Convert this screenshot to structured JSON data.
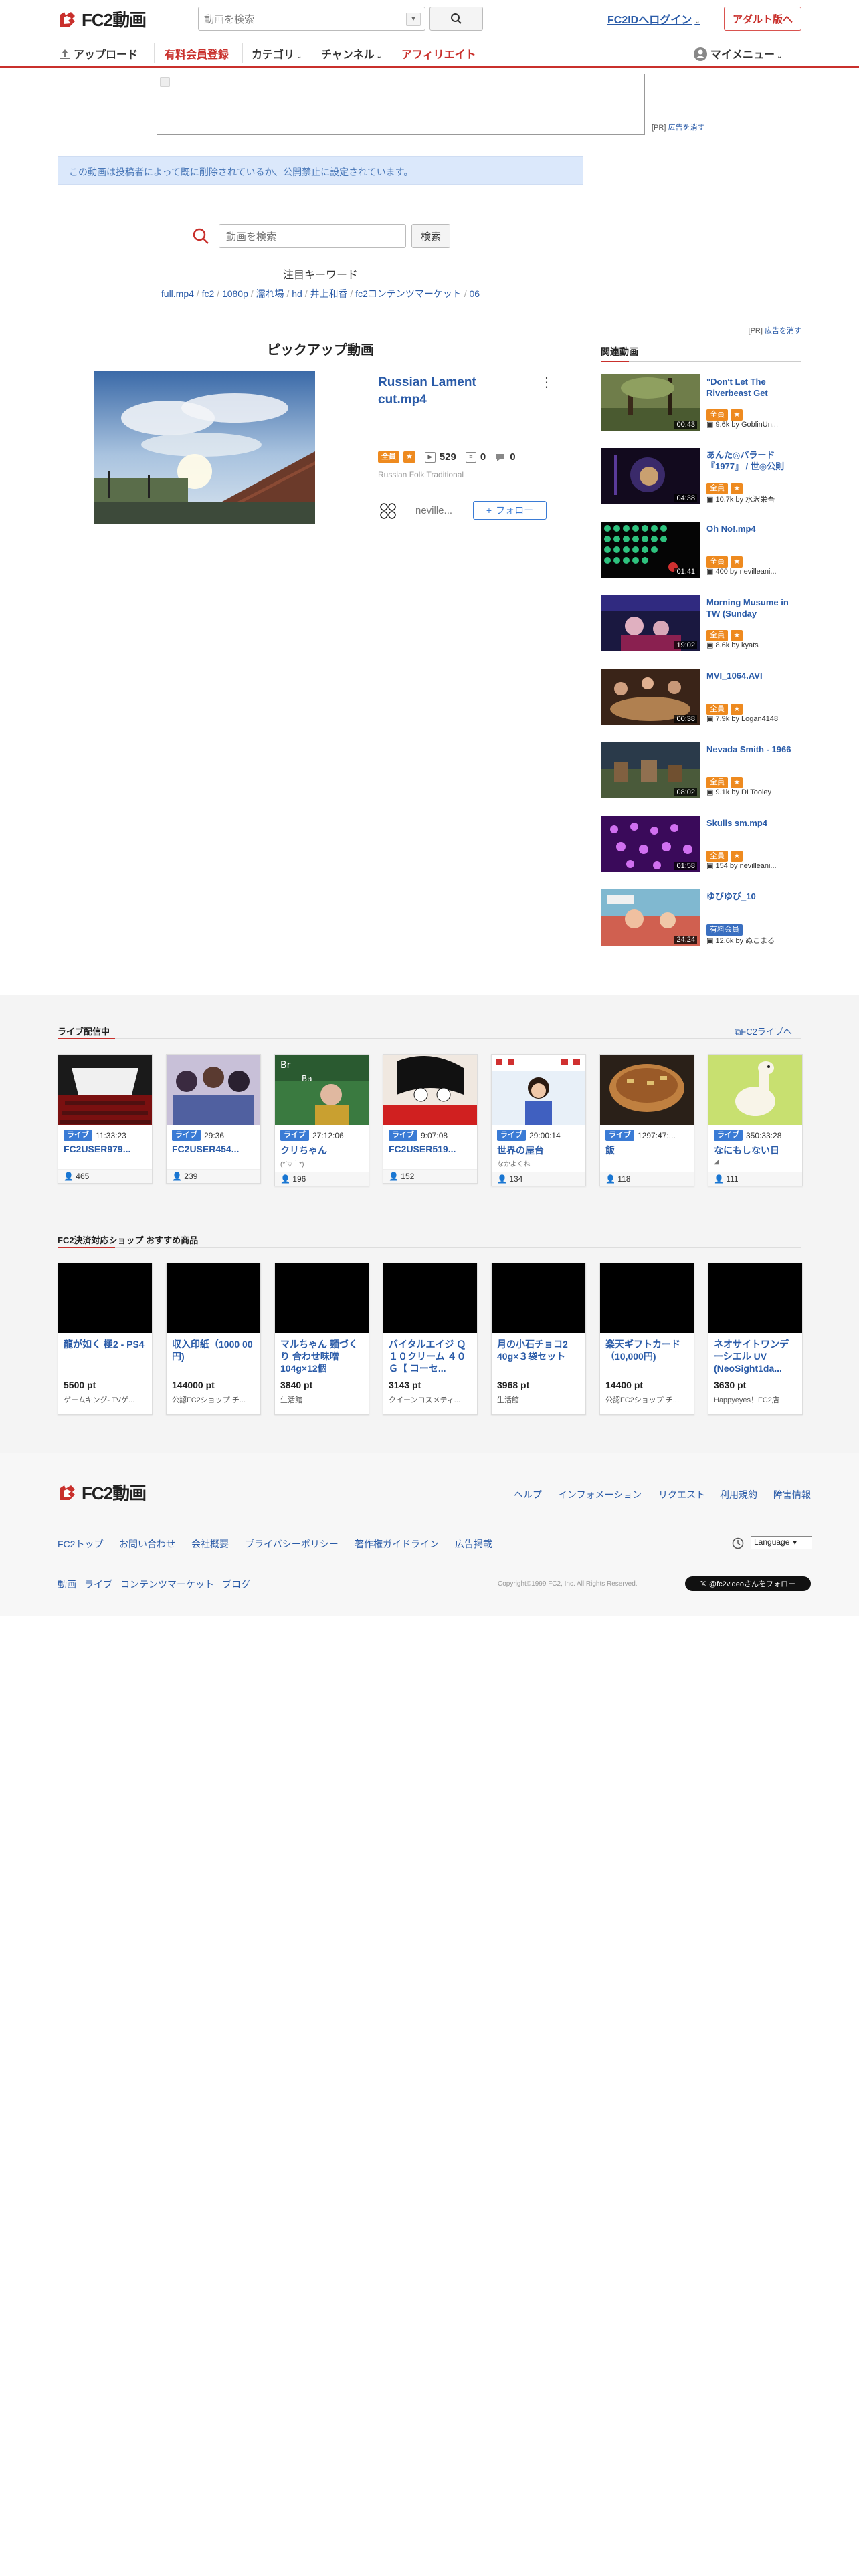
{
  "header": {
    "logo": "FC2動画",
    "search_placeholder": "動画を検索",
    "login": "FC2IDへログイン",
    "adult": "アダルト版へ"
  },
  "nav": {
    "upload": "アップロード",
    "premium": "有料会員登録",
    "category": "カテゴリ",
    "channel": "チャンネル",
    "affiliate": "アフィリエイト",
    "mymenu": "マイメニュー"
  },
  "ad": {
    "pr": "[PR]",
    "hide": "広告を消す"
  },
  "notice": "この動画は投稿者によって既に削除されているか、公開禁止に設定されています。",
  "panel": {
    "search_placeholder": "動画を検索",
    "search_button": "検索",
    "keyword_title": "注目キーワード",
    "keywords": [
      "full.mp4",
      "fc2",
      "1080p",
      "濡れ場",
      "hd",
      "井上和香",
      "fc2コンテンツマーケット",
      "06"
    ],
    "pickup_title": "ピックアップ動画",
    "pickup": {
      "title": "Russian Lament cut.mp4",
      "badge_all": "全員",
      "views": "529",
      "comments": "0",
      "likes": "0",
      "tags": "Russian Folk Traditional",
      "user": "neville...",
      "follow": "フォロー"
    }
  },
  "sidebar": {
    "pr": "[PR]",
    "hide": "広告を消す",
    "heading": "関連動画",
    "items": [
      {
        "title": "\"Don't Let The Riverbeast Get",
        "duration": "00:43",
        "badge": "全員",
        "views": "9.6k",
        "by": "by GoblinUn..."
      },
      {
        "title": "あんた◎バラード『1977』 / 世◎公則",
        "duration": "04:38",
        "badge": "全員",
        "views": "10.7k",
        "by": "by 水沢栄吾"
      },
      {
        "title": "Oh No!.mp4",
        "duration": "01:41",
        "badge": "全員",
        "views": "400",
        "by": "by nevilleani..."
      },
      {
        "title": "Morning Musume in TW (Sunday",
        "duration": "19:02",
        "badge": "全員",
        "views": "8.6k",
        "by": "by kyats"
      },
      {
        "title": "MVI_1064.AVI",
        "duration": "00:38",
        "badge": "全員",
        "views": "7.9k",
        "by": "by Logan4148"
      },
      {
        "title": "Nevada Smith - 1966",
        "duration": "08:02",
        "badge": "全員",
        "views": "9.1k",
        "by": "by DLTooley"
      },
      {
        "title": "Skulls sm.mp4",
        "duration": "01:58",
        "badge": "全員",
        "views": "154",
        "by": "by nevilleani..."
      },
      {
        "title": "ゆびゆび_10",
        "duration": "24:24",
        "badge": "有料会員",
        "views": "12.6k",
        "by": "by ぬこまる"
      }
    ]
  },
  "live": {
    "heading": "ライブ配信中",
    "link": "FC2ライブへ",
    "badge": "ライブ",
    "items": [
      {
        "time": "11:33:23",
        "name": "FC2USER979...",
        "sub": "",
        "viewers": "465"
      },
      {
        "time": "29:36",
        "name": "FC2USER454...",
        "sub": "",
        "viewers": "239"
      },
      {
        "time": "27:12:06",
        "name": "クリちゃん",
        "sub": "(*´▽｀*)",
        "viewers": "196"
      },
      {
        "time": "9:07:08",
        "name": "FC2USER519...",
        "sub": "",
        "viewers": "152"
      },
      {
        "time": "29:00:14",
        "name": "世界の屋台",
        "sub": "なかよくね",
        "viewers": "134"
      },
      {
        "time": "1297:47:...",
        "name": "飯",
        "sub": "",
        "viewers": "118"
      },
      {
        "time": "350:33:28",
        "name": "なにもしない日",
        "sub": "◢",
        "viewers": "111"
      }
    ]
  },
  "shop": {
    "heading": "FC2決済対応ショップ おすすめ商品",
    "items": [
      {
        "name": "龍が如く 極2 - PS4",
        "price": "5500 pt",
        "store": "ゲームキング- TVゲ..."
      },
      {
        "name": "収入印紙（1000 00円)",
        "price": "144000 pt",
        "store": "公認FC2ショップ チ..."
      },
      {
        "name": "マルちゃん 麺づくり 合わせ味噌 104g×12個",
        "price": "3840 pt",
        "store": "生活館"
      },
      {
        "name": "バイタルエイジ Ｑ１０クリーム ４０Ｇ【 コーセ...",
        "price": "3143 pt",
        "store": "クイーンコスメティ..."
      },
      {
        "name": "月の小石チョコ2 40g×３袋セット",
        "price": "3968 pt",
        "store": "生活館"
      },
      {
        "name": "楽天ギフトカード（10,000円)",
        "price": "14400 pt",
        "store": "公認FC2ショップ チ..."
      },
      {
        "name": "ネオサイトワンデーシエル UV (NeoSight1da...",
        "price": "3630 pt",
        "store": "Happyeyes！FC2店"
      }
    ]
  },
  "footer": {
    "logo": "FC2動画",
    "top_links": [
      "ヘルプ",
      "インフォメーション",
      "リクエスト",
      "利用規約",
      "障害情報"
    ],
    "mid_links": [
      "FC2トップ",
      "お問い合わせ",
      "会社概要",
      "プライバシーポリシー",
      "著作権ガイドライン",
      "広告掲載"
    ],
    "language": "Language",
    "bottom_links": [
      "動画",
      "ライブ",
      "コンテンツマーケット",
      "ブログ"
    ],
    "copyright": "Copyright©1999 FC2, Inc. All Rights Reserved.",
    "x_follow": "@fc2videoさんをフォロー"
  }
}
